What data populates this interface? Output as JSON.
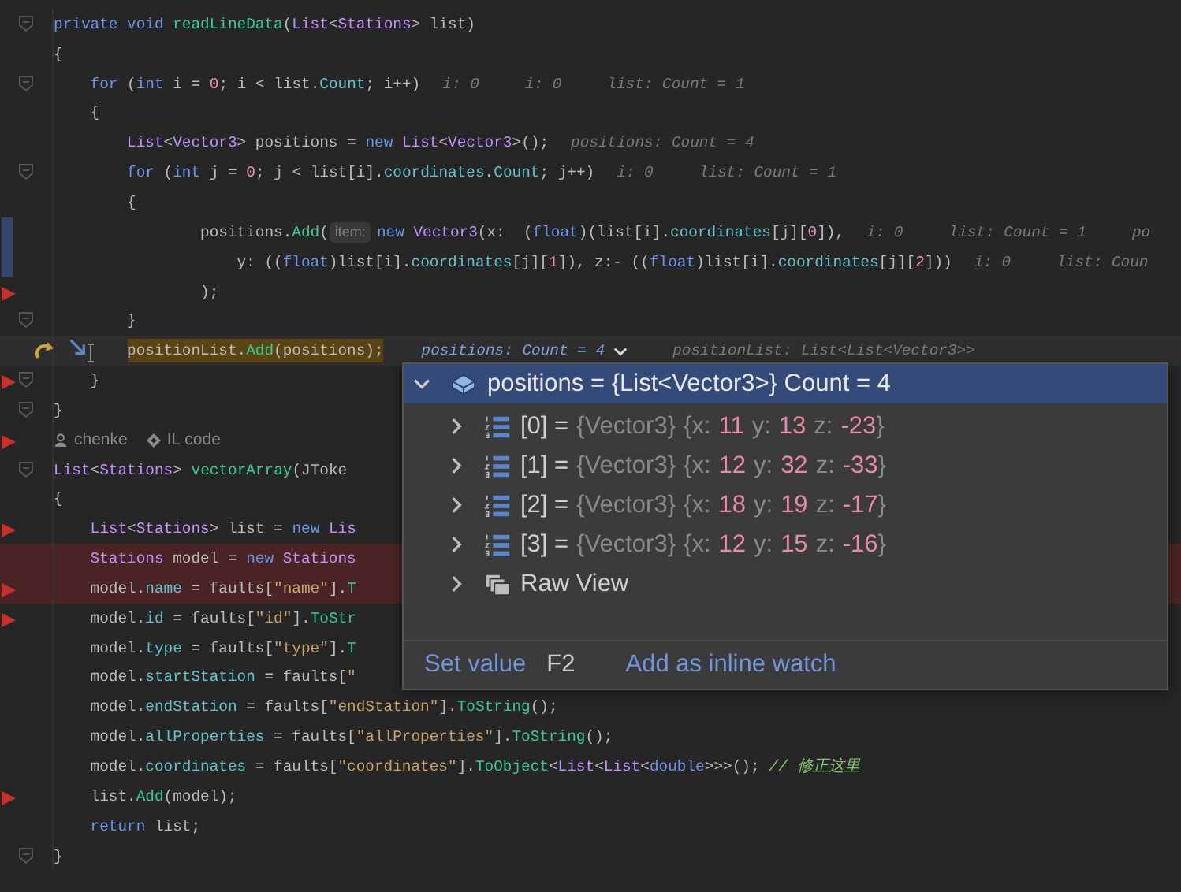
{
  "editor": {
    "lines": [
      {
        "kind": "code",
        "breakpoint": false,
        "fold": true,
        "changed": false,
        "error": false,
        "current": false,
        "tokens": [
          {
            "kind": "kw",
            "text": "private void "
          },
          {
            "kind": "fn",
            "text": "readLineData"
          },
          {
            "kind": "plain",
            "text": "("
          },
          {
            "kind": "type",
            "text": "List"
          },
          {
            "kind": "plain",
            "text": "<"
          },
          {
            "kind": "type",
            "text": "Stations"
          },
          {
            "kind": "plain",
            "text": "> list)"
          }
        ]
      },
      {
        "kind": "code",
        "breakpoint": false,
        "fold": false,
        "changed": false,
        "error": false,
        "current": false,
        "tokens": [
          {
            "kind": "plain",
            "text": "{"
          }
        ],
        "children": [
          {
            "kind": "code",
            "breakpoint": false,
            "fold": true,
            "changed": false,
            "error": false,
            "current": false,
            "tokens": [
              {
                "kind": "kw",
                "text": "for"
              },
              {
                "kind": "plain",
                "text": " ("
              },
              {
                "kind": "kw",
                "text": "int"
              },
              {
                "kind": "plain",
                "text": " i = "
              },
              {
                "kind": "num",
                "text": "0"
              },
              {
                "kind": "plain",
                "text": "; i < list."
              },
              {
                "kind": "field",
                "text": "Count"
              },
              {
                "kind": "plain",
                "text": "; i++)"
              }
            ],
            "hints": [
              {
                "kind": "value",
                "text": "i: 0"
              },
              {
                "kind": "value",
                "text": "i: 0"
              },
              {
                "kind": "value",
                "text": "list: Count = 1"
              }
            ]
          },
          {
            "kind": "code",
            "breakpoint": false,
            "fold": false,
            "changed": false,
            "error": false,
            "current": false,
            "tokens": [
              {
                "kind": "plain",
                "text": "{"
              }
            ],
            "children": [
              {
                "kind": "code",
                "breakpoint": false,
                "fold": false,
                "changed": false,
                "error": false,
                "current": false,
                "tokens": [
                  {
                    "kind": "type",
                    "text": "List"
                  },
                  {
                    "kind": "plain",
                    "text": "<"
                  },
                  {
                    "kind": "type",
                    "text": "Vector3"
                  },
                  {
                    "kind": "plain",
                    "text": "> positions = "
                  },
                  {
                    "kind": "kw",
                    "text": "new "
                  },
                  {
                    "kind": "type",
                    "text": "List"
                  },
                  {
                    "kind": "plain",
                    "text": "<"
                  },
                  {
                    "kind": "type",
                    "text": "Vector3"
                  },
                  {
                    "kind": "plain",
                    "text": ">();"
                  }
                ],
                "hints": [
                  {
                    "kind": "value",
                    "text": "positions: Count = 4"
                  }
                ]
              },
              {
                "kind": "code",
                "breakpoint": false,
                "fold": true,
                "changed": false,
                "error": false,
                "current": false,
                "tokens": [
                  {
                    "kind": "kw",
                    "text": "for"
                  },
                  {
                    "kind": "plain",
                    "text": " ("
                  },
                  {
                    "kind": "kw",
                    "text": "int"
                  },
                  {
                    "kind": "plain",
                    "text": " j = "
                  },
                  {
                    "kind": "num",
                    "text": "0"
                  },
                  {
                    "kind": "plain",
                    "text": "; j < list[i]."
                  },
                  {
                    "kind": "field",
                    "text": "coordinates"
                  },
                  {
                    "kind": "plain",
                    "text": "."
                  },
                  {
                    "kind": "field",
                    "text": "Count"
                  },
                  {
                    "kind": "plain",
                    "text": "; j++)"
                  }
                ],
                "hints": [
                  {
                    "kind": "value",
                    "text": "i: 0"
                  },
                  {
                    "kind": "value",
                    "text": "list: Count = 1"
                  }
                ]
              },
              {
                "kind": "code",
                "breakpoint": false,
                "fold": false,
                "changed": false,
                "error": false,
                "current": false,
                "tokens": [
                  {
                    "kind": "plain",
                    "text": "{"
                  }
                ],
                "children": [
                  {
                    "kind": "code",
                    "breakpoint": false,
                    "fold": false,
                    "changed": true,
                    "error": false,
                    "current": false,
                    "tokens": [
                      {
                        "kind": "plain",
                        "text": "positions."
                      },
                      {
                        "kind": "fn",
                        "text": "Add"
                      },
                      {
                        "kind": "plain",
                        "text": "("
                      },
                      {
                        "kind": "param",
                        "text": "item:"
                      },
                      {
                        "kind": "kw",
                        "text": "new "
                      },
                      {
                        "kind": "type",
                        "text": "Vector3"
                      },
                      {
                        "kind": "plain",
                        "text": "(x:  ("
                      },
                      {
                        "kind": "kw",
                        "text": "float"
                      },
                      {
                        "kind": "plain",
                        "text": ")(list[i]."
                      },
                      {
                        "kind": "field",
                        "text": "coordinates"
                      },
                      {
                        "kind": "plain",
                        "text": "[j]["
                      },
                      {
                        "kind": "num",
                        "text": "0"
                      },
                      {
                        "kind": "plain",
                        "text": "]),"
                      }
                    ],
                    "hints": [
                      {
                        "kind": "value",
                        "text": "i: 0"
                      },
                      {
                        "kind": "value",
                        "text": "list: Count = 1"
                      },
                      {
                        "kind": "value",
                        "text": "po"
                      }
                    ],
                    "children": [
                      {
                        "kind": "code",
                        "breakpoint": false,
                        "fold": false,
                        "changed": true,
                        "error": false,
                        "current": false,
                        "tokens": [
                          {
                            "kind": "plain",
                            "text": "y: (("
                          },
                          {
                            "kind": "kw",
                            "text": "float"
                          },
                          {
                            "kind": "plain",
                            "text": ")list[i]."
                          },
                          {
                            "kind": "field",
                            "text": "coordinates"
                          },
                          {
                            "kind": "plain",
                            "text": "[j]["
                          },
                          {
                            "kind": "num",
                            "text": "1"
                          },
                          {
                            "kind": "plain",
                            "text": "]), z:- (("
                          },
                          {
                            "kind": "kw",
                            "text": "float"
                          },
                          {
                            "kind": "plain",
                            "text": ")list[i]."
                          },
                          {
                            "kind": "field",
                            "text": "coordinates"
                          },
                          {
                            "kind": "plain",
                            "text": "[j]["
                          },
                          {
                            "kind": "num",
                            "text": "2"
                          },
                          {
                            "kind": "plain",
                            "text": "]))"
                          }
                        ],
                        "hints": [
                          {
                            "kind": "value",
                            "text": "i: 0"
                          },
                          {
                            "kind": "value",
                            "text": "list: Coun"
                          }
                        ]
                      }
                    ]
                  },
                  {
                    "kind": "code",
                    "breakpoint": true,
                    "fold": false,
                    "changed": false,
                    "error": false,
                    "current": false,
                    "tokens": [
                      {
                        "kind": "plain",
                        "text": ");"
                      }
                    ]
                  }
                ]
              },
              {
                "kind": "code",
                "breakpoint": false,
                "fold": true,
                "changed": false,
                "error": false,
                "current": false,
                "tokens": [
                  {
                    "kind": "plain",
                    "text": "}"
                  }
                ]
              },
              {
                "kind": "code",
                "breakpoint": false,
                "fold": false,
                "changed": false,
                "error": false,
                "current": true,
                "tokens": [
                  {
                    "kind": "plain",
                    "text": "positionList."
                  },
                  {
                    "kind": "fn",
                    "text": "Add"
                  },
                  {
                    "kind": "plain",
                    "text": "(positions);"
                  }
                ],
                "hints": [
                  {
                    "kind": "expandable",
                    "text": "positions: Count = 4"
                  },
                  {
                    "kind": "value",
                    "text": "positionList: List<List<Vector3>>"
                  }
                ]
              }
            ]
          },
          {
            "kind": "code",
            "breakpoint": true,
            "fold": true,
            "changed": false,
            "error": false,
            "current": false,
            "tokens": [
              {
                "kind": "plain",
                "text": "}"
              }
            ]
          }
        ]
      },
      {
        "kind": "code",
        "breakpoint": false,
        "fold": true,
        "changed": false,
        "error": false,
        "current": false,
        "tokens": [
          {
            "kind": "plain",
            "text": "}"
          }
        ]
      },
      {
        "kind": "author",
        "breakpoint": true,
        "fold": false,
        "changed": false,
        "error": false,
        "current": false,
        "author": "chenke",
        "link": "IL code"
      },
      {
        "kind": "code",
        "breakpoint": false,
        "fold": true,
        "changed": false,
        "error": false,
        "current": false,
        "tokens": [
          {
            "kind": "type",
            "text": "List"
          },
          {
            "kind": "plain",
            "text": "<"
          },
          {
            "kind": "type",
            "text": "Stations"
          },
          {
            "kind": "plain",
            "text": "> "
          },
          {
            "kind": "fn",
            "text": "vectorArray"
          },
          {
            "kind": "plain",
            "text": "(JToke"
          }
        ]
      },
      {
        "kind": "code",
        "breakpoint": false,
        "fold": false,
        "changed": false,
        "error": false,
        "current": false,
        "tokens": [
          {
            "kind": "plain",
            "text": "{"
          }
        ],
        "children": [
          {
            "kind": "code",
            "breakpoint": true,
            "fold": false,
            "changed": false,
            "error": false,
            "current": false,
            "tokens": [
              {
                "kind": "type",
                "text": "List"
              },
              {
                "kind": "plain",
                "text": "<"
              },
              {
                "kind": "type",
                "text": "Stations"
              },
              {
                "kind": "plain",
                "text": "> list = "
              },
              {
                "kind": "kw",
                "text": "new "
              },
              {
                "kind": "type",
                "text": "Lis"
              }
            ]
          },
          {
            "kind": "code",
            "breakpoint": false,
            "fold": false,
            "changed": false,
            "error": true,
            "current": false,
            "tokens": [
              {
                "kind": "type",
                "text": "Stations"
              },
              {
                "kind": "plain",
                "text": " model = "
              },
              {
                "kind": "kw",
                "text": "new "
              },
              {
                "kind": "type",
                "text": "Stations"
              }
            ]
          },
          {
            "kind": "code",
            "breakpoint": true,
            "fold": false,
            "changed": false,
            "error": true,
            "current": false,
            "tokens": [
              {
                "kind": "plain",
                "text": "model."
              },
              {
                "kind": "field",
                "text": "name"
              },
              {
                "kind": "plain",
                "text": " = faults["
              },
              {
                "kind": "str",
                "text": "\"name\""
              },
              {
                "kind": "plain",
                "text": "]."
              },
              {
                "kind": "fn",
                "text": "T"
              }
            ]
          },
          {
            "kind": "code",
            "breakpoint": true,
            "fold": false,
            "changed": false,
            "error": false,
            "current": false,
            "tokens": [
              {
                "kind": "plain",
                "text": "model."
              },
              {
                "kind": "field",
                "text": "id"
              },
              {
                "kind": "plain",
                "text": " = faults["
              },
              {
                "kind": "str",
                "text": "\"id\""
              },
              {
                "kind": "plain",
                "text": "]."
              },
              {
                "kind": "fn",
                "text": "ToStr"
              }
            ]
          },
          {
            "kind": "code",
            "breakpoint": false,
            "fold": false,
            "changed": false,
            "error": false,
            "current": false,
            "tokens": [
              {
                "kind": "plain",
                "text": "model."
              },
              {
                "kind": "field",
                "text": "type"
              },
              {
                "kind": "plain",
                "text": " = faults["
              },
              {
                "kind": "str",
                "text": "\"type\""
              },
              {
                "kind": "plain",
                "text": "]."
              },
              {
                "kind": "fn",
                "text": "T"
              }
            ]
          },
          {
            "kind": "code",
            "breakpoint": false,
            "fold": false,
            "changed": false,
            "error": false,
            "current": false,
            "tokens": [
              {
                "kind": "plain",
                "text": "model."
              },
              {
                "kind": "field",
                "text": "startStation"
              },
              {
                "kind": "plain",
                "text": " = faults["
              },
              {
                "kind": "str",
                "text": "\""
              }
            ]
          },
          {
            "kind": "code",
            "breakpoint": false,
            "fold": false,
            "changed": false,
            "error": false,
            "current": false,
            "tokens": [
              {
                "kind": "plain",
                "text": "model."
              },
              {
                "kind": "field",
                "text": "endStation"
              },
              {
                "kind": "plain",
                "text": " = faults["
              },
              {
                "kind": "str",
                "text": "\"endStation\""
              },
              {
                "kind": "plain",
                "text": "]."
              },
              {
                "kind": "fn",
                "text": "ToString"
              },
              {
                "kind": "plain",
                "text": "();"
              }
            ]
          },
          {
            "kind": "code",
            "breakpoint": false,
            "fold": false,
            "changed": false,
            "error": false,
            "current": false,
            "tokens": [
              {
                "kind": "plain",
                "text": "model."
              },
              {
                "kind": "field",
                "text": "allProperties"
              },
              {
                "kind": "plain",
                "text": " = faults["
              },
              {
                "kind": "str",
                "text": "\"allProperties\""
              },
              {
                "kind": "plain",
                "text": "]."
              },
              {
                "kind": "fn",
                "text": "ToString"
              },
              {
                "kind": "plain",
                "text": "();"
              }
            ]
          },
          {
            "kind": "code",
            "breakpoint": false,
            "fold": false,
            "changed": false,
            "error": false,
            "current": false,
            "tokens": [
              {
                "kind": "plain",
                "text": "model."
              },
              {
                "kind": "field",
                "text": "coordinates"
              },
              {
                "kind": "plain",
                "text": " = faults["
              },
              {
                "kind": "str",
                "text": "\"coordinates\""
              },
              {
                "kind": "plain",
                "text": "]."
              },
              {
                "kind": "fn",
                "text": "ToObject"
              },
              {
                "kind": "plain",
                "text": "<"
              },
              {
                "kind": "type",
                "text": "List"
              },
              {
                "kind": "plain",
                "text": "<"
              },
              {
                "kind": "type",
                "text": "List"
              },
              {
                "kind": "plain",
                "text": "<"
              },
              {
                "kind": "kw",
                "text": "double"
              },
              {
                "kind": "plain",
                "text": ">>>(); "
              },
              {
                "kind": "comment",
                "text": "// 修正这里"
              }
            ]
          },
          {
            "kind": "code",
            "breakpoint": true,
            "fold": false,
            "changed": false,
            "error": false,
            "current": false,
            "tokens": [
              {
                "kind": "plain",
                "text": "list."
              },
              {
                "kind": "fn",
                "text": "Add"
              },
              {
                "kind": "plain",
                "text": "(model);"
              }
            ]
          },
          {
            "kind": "code",
            "breakpoint": false,
            "fold": false,
            "changed": false,
            "error": false,
            "current": false,
            "tokens": [
              {
                "kind": "kw",
                "text": "return"
              },
              {
                "kind": "plain",
                "text": " list;"
              }
            ]
          }
        ]
      },
      {
        "kind": "code",
        "breakpoint": false,
        "fold": true,
        "changed": false,
        "error": false,
        "current": false,
        "tokens": [
          {
            "kind": "plain",
            "text": "}"
          }
        ]
      }
    ]
  },
  "debug_popup": {
    "header": {
      "expanded": true,
      "text": "positions = {List<Vector3>} Count = 4"
    },
    "items": [
      {
        "kind": "vector",
        "expanded": false,
        "parts": [
          {
            "kind": "name",
            "text": "[0] ="
          },
          {
            "kind": "type",
            "text": "{Vector3}"
          },
          {
            "kind": "punct",
            "text": "{x:"
          },
          {
            "kind": "num",
            "text": "11"
          },
          {
            "kind": "punct",
            "text": "y:"
          },
          {
            "kind": "num",
            "text": "13"
          },
          {
            "kind": "punct",
            "text": "z:"
          },
          {
            "kind": "num",
            "text": "-23"
          },
          {
            "kind": "close",
            "text": "}"
          }
        ]
      },
      {
        "kind": "vector",
        "expanded": false,
        "parts": [
          {
            "kind": "name",
            "text": "[1] ="
          },
          {
            "kind": "type",
            "text": "{Vector3}"
          },
          {
            "kind": "punct",
            "text": "{x:"
          },
          {
            "kind": "num",
            "text": "12"
          },
          {
            "kind": "punct",
            "text": "y:"
          },
          {
            "kind": "num",
            "text": "32"
          },
          {
            "kind": "punct",
            "text": "z:"
          },
          {
            "kind": "num",
            "text": "-33"
          },
          {
            "kind": "close",
            "text": "}"
          }
        ]
      },
      {
        "kind": "vector",
        "expanded": false,
        "parts": [
          {
            "kind": "name",
            "text": "[2] ="
          },
          {
            "kind": "type",
            "text": "{Vector3}"
          },
          {
            "kind": "punct",
            "text": "{x:"
          },
          {
            "kind": "num",
            "text": "18"
          },
          {
            "kind": "punct",
            "text": "y:"
          },
          {
            "kind": "num",
            "text": "19"
          },
          {
            "kind": "punct",
            "text": "z:"
          },
          {
            "kind": "num",
            "text": "-17"
          },
          {
            "kind": "close",
            "text": "}"
          }
        ]
      },
      {
        "kind": "vector",
        "expanded": false,
        "parts": [
          {
            "kind": "name",
            "text": "[3] ="
          },
          {
            "kind": "type",
            "text": "{Vector3}"
          },
          {
            "kind": "punct",
            "text": "{x:"
          },
          {
            "kind": "num",
            "text": "12"
          },
          {
            "kind": "punct",
            "text": "y:"
          },
          {
            "kind": "num",
            "text": "15"
          },
          {
            "kind": "punct",
            "text": "z:"
          },
          {
            "kind": "num",
            "text": "-16"
          },
          {
            "kind": "close",
            "text": "}"
          }
        ]
      },
      {
        "kind": "raw",
        "expanded": false,
        "parts": [
          {
            "kind": "name",
            "text": "Raw View"
          }
        ]
      }
    ],
    "actions": [
      {
        "label": "Set value",
        "shortcut": "F2"
      },
      {
        "label": "Add as inline watch"
      }
    ]
  }
}
